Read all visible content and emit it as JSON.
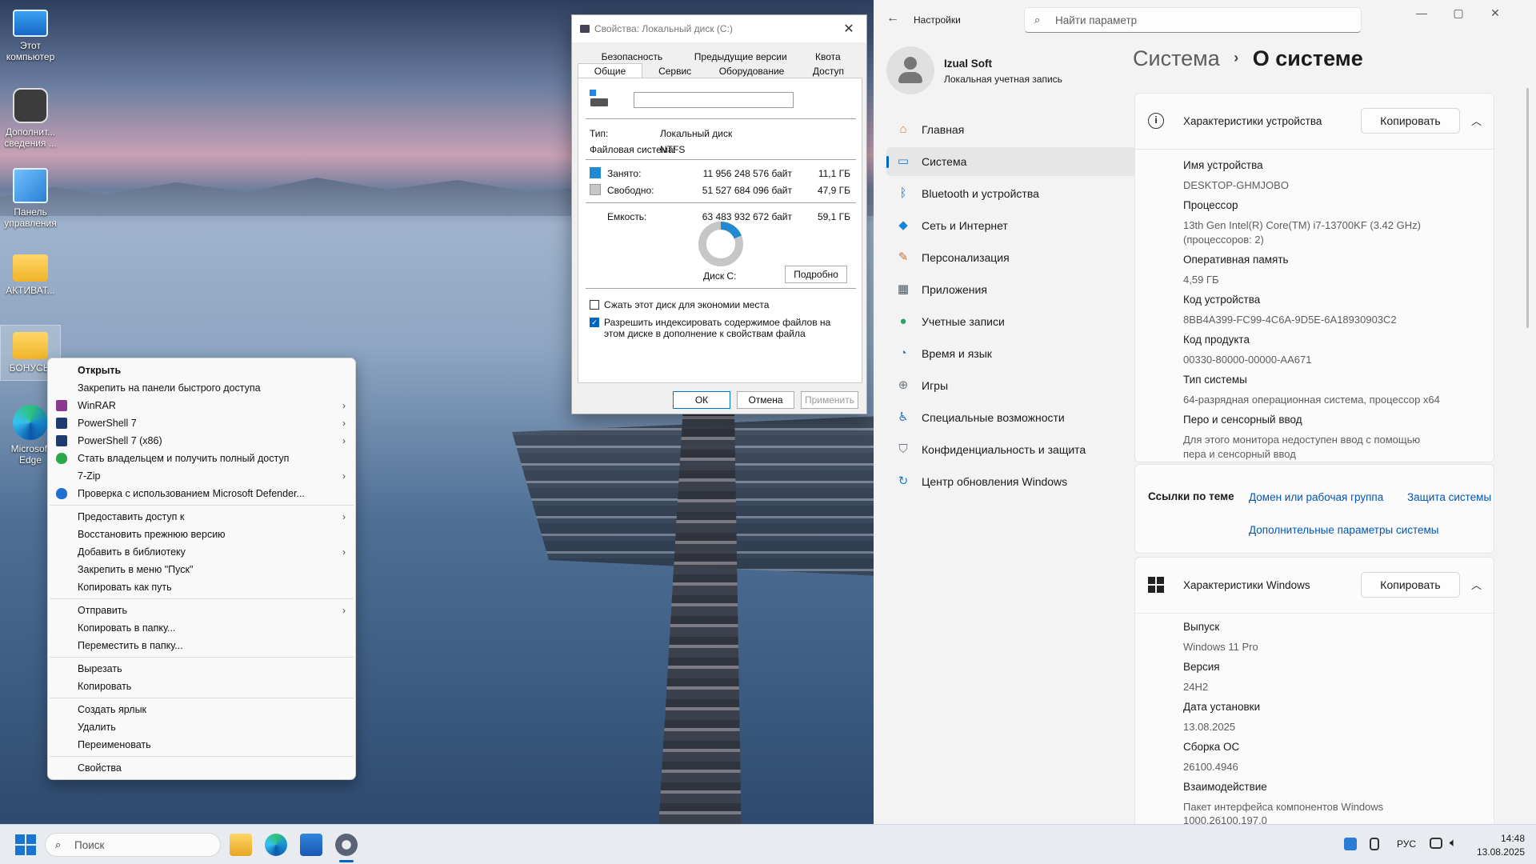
{
  "desktop": {
    "icons": [
      {
        "label": "Этот компьютер"
      },
      {
        "label": "Дополнит... сведения ..."
      },
      {
        "label": "Панель управления"
      },
      {
        "label": "АКТИВАТ..."
      },
      {
        "label": "БОНУСЫ"
      },
      {
        "label": "Microsoft Edge"
      }
    ]
  },
  "context_menu": {
    "items": [
      {
        "label": "Открыть",
        "bold": true
      },
      {
        "label": "Закрепить на панели быстрого доступа"
      },
      {
        "label": "WinRAR",
        "submenu": true,
        "icon": "winrar-icon"
      },
      {
        "label": "PowerShell 7",
        "submenu": true,
        "icon": "powershell-icon"
      },
      {
        "label": "PowerShell 7 (x86)",
        "submenu": true,
        "icon": "powershell-icon"
      },
      {
        "label": "Стать владельцем и получить полный доступ",
        "icon": "shield-check-icon"
      },
      {
        "label": "7-Zip",
        "submenu": true
      },
      {
        "label": "Проверка с использованием Microsoft Defender...",
        "icon": "defender-icon"
      },
      {
        "sep": true
      },
      {
        "label": "Предоставить доступ к",
        "submenu": true
      },
      {
        "label": "Восстановить прежнюю версию"
      },
      {
        "label": "Добавить в библиотеку",
        "submenu": true
      },
      {
        "label": "Закрепить в меню \"Пуск\""
      },
      {
        "label": "Копировать как путь"
      },
      {
        "sep": true
      },
      {
        "label": "Отправить",
        "submenu": true
      },
      {
        "label": "Копировать в папку..."
      },
      {
        "label": "Переместить в папку..."
      },
      {
        "sep": true
      },
      {
        "label": "Вырезать"
      },
      {
        "label": "Копировать"
      },
      {
        "sep": true
      },
      {
        "label": "Создать ярлык"
      },
      {
        "label": "Удалить"
      },
      {
        "label": "Переименовать"
      },
      {
        "sep": true
      },
      {
        "label": "Свойства"
      }
    ]
  },
  "props": {
    "title": "Свойства: Локальный диск (C:)",
    "tabs_row1": [
      "Безопасность",
      "Предыдущие версии",
      "Квота"
    ],
    "tabs_row2": [
      "Общие",
      "Сервис",
      "Оборудование",
      "Доступ"
    ],
    "name_value": "",
    "type_label": "Тип:",
    "type_value": "Локальный диск",
    "fs_label": "Файловая система:",
    "fs_value": "NTFS",
    "used_label": "Занято:",
    "used_bytes": "11 956 248 576 байт",
    "used_gb": "11,1 ГБ",
    "free_label": "Свободно:",
    "free_bytes": "51 527 684 096 байт",
    "free_gb": "47,9 ГБ",
    "cap_label": "Емкость:",
    "cap_bytes": "63 483 932 672 байт",
    "cap_gb": "59,1 ГБ",
    "used_fraction": 0.188,
    "disk_label": "Диск C:",
    "details_btn": "Подробно",
    "compress_label": "Сжать этот диск для экономии места",
    "compress_checked": false,
    "index_label": "Разрешить индексировать содержимое файлов на этом диске в дополнение к свойствам файла",
    "index_checked": true,
    "ok": "ОК",
    "cancel": "Отмена",
    "apply": "Применить",
    "used_color": "#1f8ad2",
    "free_color": "#c6c6c6"
  },
  "settings": {
    "app_title": "Настройки",
    "search_placeholder": "Найти параметр",
    "user_name": "Izual Soft",
    "user_sub": "Локальная учетная запись",
    "bc_parent": "Система",
    "bc_current": "О системе",
    "nav": [
      {
        "label": "Главная",
        "icon": "home-icon"
      },
      {
        "label": "Система",
        "icon": "system-icon",
        "active": true
      },
      {
        "label": "Bluetooth и устройства",
        "icon": "bluetooth-icon"
      },
      {
        "label": "Сеть и Интернет",
        "icon": "wifi-icon"
      },
      {
        "label": "Персонализация",
        "icon": "brush-icon"
      },
      {
        "label": "Приложения",
        "icon": "apps-icon"
      },
      {
        "label": "Учетные записи",
        "icon": "account-icon"
      },
      {
        "label": "Время и язык",
        "icon": "globe-clock-icon"
      },
      {
        "label": "Игры",
        "icon": "gamepad-icon"
      },
      {
        "label": "Специальные возможности",
        "icon": "accessibility-icon"
      },
      {
        "label": "Конфиденциальность и защита",
        "icon": "shield-icon"
      },
      {
        "label": "Центр обновления Windows",
        "icon": "update-icon"
      }
    ],
    "device": {
      "title": "Характеристики устройства",
      "copy": "Копировать",
      "rows": [
        {
          "label": "Имя устройства",
          "value": "DESKTOP-GHMJOBO"
        },
        {
          "label": "Процессор",
          "value": "13th Gen Intel(R) Core(TM) i7-13700KF (3.42 GHz)",
          "value2": "(процессоров: 2)"
        },
        {
          "label": "Оперативная память",
          "value": "4,59 ГБ"
        },
        {
          "label": "Код устройства",
          "value": "8BB4A399-FC99-4C6A-9D5E-6A18930903C2"
        },
        {
          "label": "Код продукта",
          "value": "00330-80000-00000-AA671"
        },
        {
          "label": "Тип системы",
          "value": "64-разрядная операционная система, процессор x64"
        },
        {
          "label": "Перо и сенсорный ввод",
          "value": "Для этого монитора недоступен ввод с помощью",
          "value2": "пера и сенсорный ввод"
        }
      ]
    },
    "links": {
      "title": "Ссылки по теме",
      "domain": "Домен или рабочая группа",
      "protection": "Защита системы",
      "advanced": "Дополнительные параметры системы"
    },
    "windows": {
      "title": "Характеристики Windows",
      "copy": "Копировать",
      "rows": [
        {
          "label": "Выпуск",
          "value": "Windows 11 Pro"
        },
        {
          "label": "Версия",
          "value": "24H2"
        },
        {
          "label": "Дата установки",
          "value": "13.08.2025"
        },
        {
          "label": "Сборка ОС",
          "value": "26100.4946"
        },
        {
          "label": "Взаимодействие",
          "value": "Пакет интерфейса компонентов Windows",
          "value2": "1000.26100.197.0"
        }
      ]
    }
  },
  "taskbar": {
    "search_placeholder": "Поиск",
    "lang": "РУС",
    "time": "14:48",
    "date": "13.08.2025"
  }
}
